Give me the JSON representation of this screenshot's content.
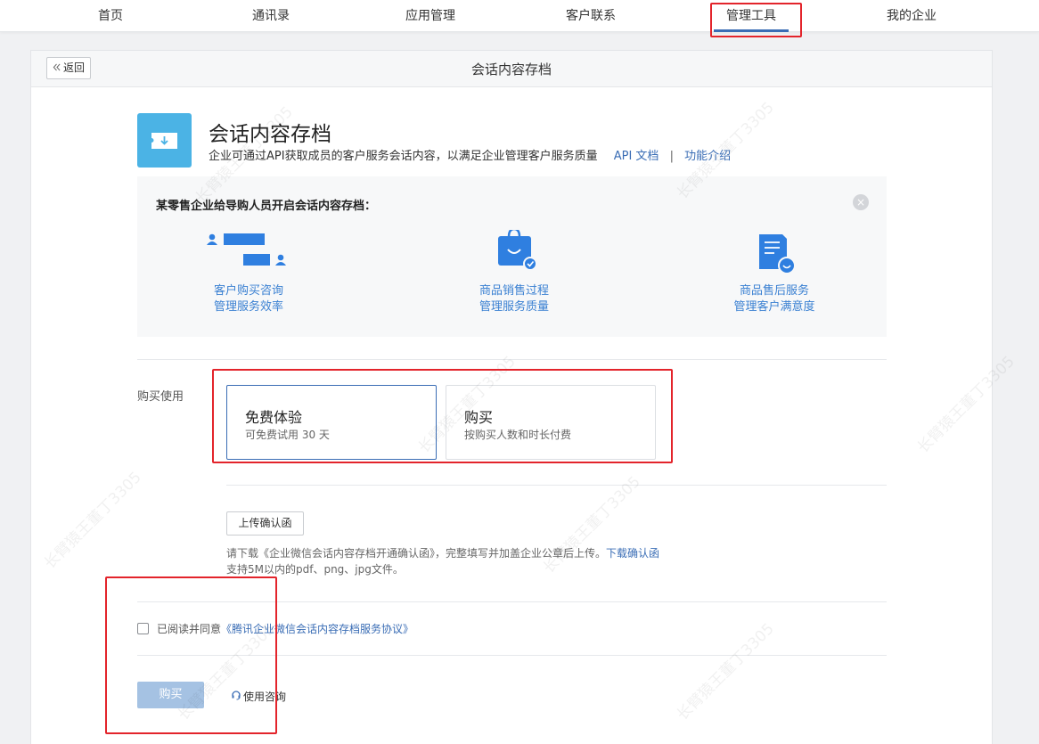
{
  "nav": {
    "items": [
      {
        "label": "首页"
      },
      {
        "label": "通讯录"
      },
      {
        "label": "应用管理"
      },
      {
        "label": "客户联系"
      },
      {
        "label": "管理工具"
      },
      {
        "label": "我的企业"
      }
    ]
  },
  "header": {
    "back_label": "返回",
    "title": "会话内容存档"
  },
  "intro": {
    "name": "会话内容存档",
    "description": "企业可通过API获取成员的客户服务会话内容，以满足企业管理客户服务质量",
    "api_doc_link": "API 文档",
    "separator": "|",
    "feature_link": "功能介绍"
  },
  "example": {
    "title": "某零售企业给导购人员开启会话内容存档：",
    "items": [
      {
        "line1": "客户购买咨询",
        "line2": "管理服务效率",
        "icon": "chat-icon"
      },
      {
        "line1": "商品销售过程",
        "line2": "管理服务质量",
        "icon": "shopping-bag-icon"
      },
      {
        "line1": "商品售后服务",
        "line2": "管理客户满意度",
        "icon": "document-smile-icon"
      }
    ]
  },
  "purchase": {
    "label": "购买使用",
    "options": [
      {
        "title": "免费体验",
        "subtitle": "可免费试用 30 天"
      },
      {
        "title": "购买",
        "subtitle": "按购买人数和时长付费"
      }
    ],
    "upload_button": "上传确认函",
    "note_text": "请下载《企业微信会话内容存档开通确认函》，完整填写并加盖企业公章后上传。",
    "note_link": "下载确认函",
    "note_line2": "支持5M以内的pdf、png、jpg文件。",
    "agree_text": "已阅读并同意",
    "agree_link": "《腾讯企业微信会话内容存档服务协议》",
    "buy_button": "购买",
    "consult_label": "使用咨询"
  },
  "watermark": "长臂猿王董丁3305",
  "colors": {
    "accent": "#3a6db5",
    "icon_bg": "#4bb3e5",
    "example_text": "#3a80d2",
    "annotation": "#e3242b",
    "buy_disabled": "#a5c2e3"
  }
}
